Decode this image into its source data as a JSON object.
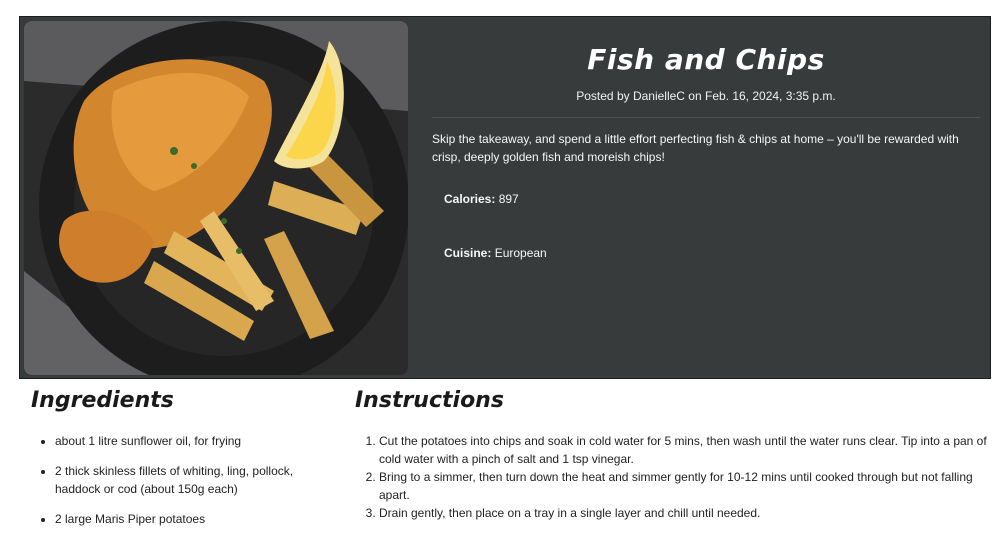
{
  "recipe": {
    "title": "Fish and Chips",
    "posted": "Posted by DanielleC on Feb. 16, 2024, 3:35 p.m.",
    "description": "Skip the takeaway, and spend a little effort perfecting fish & chips at home – you'll be rewarded with crisp, deeply golden fish and moreish chips!",
    "calories_label": "Calories:",
    "calories_value": "897",
    "cuisine_label": "Cuisine:",
    "cuisine_value": "European",
    "image_icon": "fish-and-chips-photo"
  },
  "ingredients": {
    "heading": "Ingredients",
    "items": [
      "about 1 litre sunflower oil, for frying",
      "2 thick skinless fillets of whiting, ling, pollock, haddock or cod (about 150g each)",
      "2 large Maris Piper potatoes"
    ]
  },
  "instructions": {
    "heading": "Instructions",
    "steps": [
      "Cut the potatoes into chips and soak in cold water for 5 mins, then wash until the water runs clear. Tip into a pan of cold water with a pinch of salt and 1 tsp vinegar.",
      "Bring to a simmer, then turn down the heat and simmer gently for 10-12 mins until cooked through but not falling apart.",
      "Drain gently, then place on a tray in a single layer and chill until needed."
    ]
  },
  "colors": {
    "hero_bg": "#373b3b",
    "text_light": "#ffffff",
    "text_dark": "#1a1a1a"
  }
}
